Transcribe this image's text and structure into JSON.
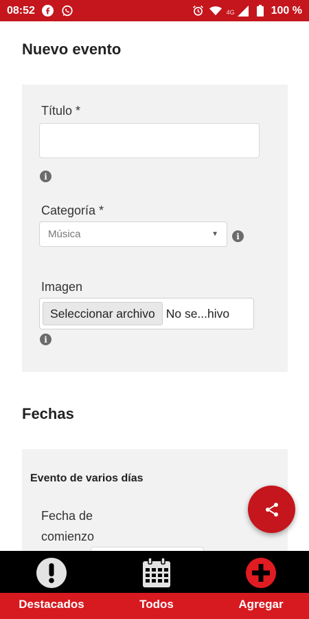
{
  "status_bar": {
    "time": "08:52",
    "network": "4G",
    "battery": "100 %"
  },
  "form": {
    "section_title": "Nuevo evento",
    "title_label": "Título *",
    "title_value": "",
    "category_label": "Categoría *",
    "category_value": "Música",
    "image_label": "Imagen",
    "file_button_label": "Seleccionar archivo",
    "file_status": "No se...hivo"
  },
  "dates": {
    "section_title": "Fechas",
    "multi_day_label": "Evento de varios días",
    "start_date_label": "Fecha de comienzo"
  },
  "bottom_nav": {
    "items": [
      {
        "label": "Destacados",
        "icon": "exclamation-circle-icon"
      },
      {
        "label": "Todos",
        "icon": "calendar-icon"
      },
      {
        "label": "Agregar",
        "icon": "plus-circle-icon"
      }
    ]
  },
  "colors": {
    "brand_red": "#c4161c",
    "nav_label_bar": "#d71920",
    "nav_bar": "#000000"
  }
}
